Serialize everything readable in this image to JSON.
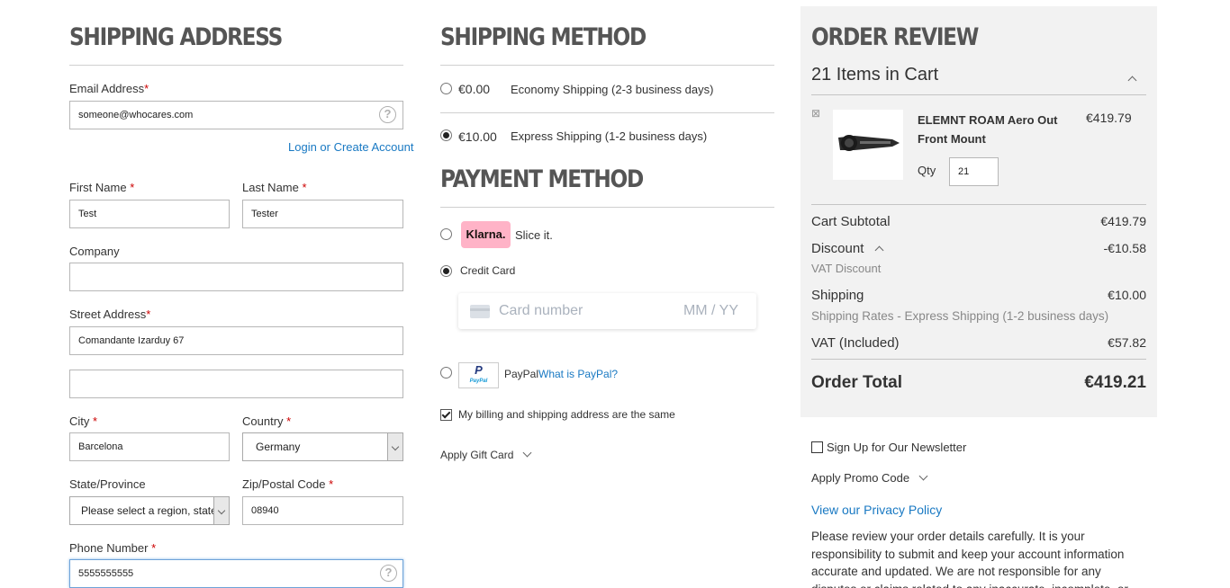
{
  "shipping_address": {
    "title": "SHIPPING ADDRESS",
    "email_label": "Email Address",
    "email_value": "someone@whocares.com",
    "login_link": "Login or Create Account",
    "first_name_label": "First Name",
    "first_name_value": "Test",
    "last_name_label": "Last Name",
    "last_name_value": "Tester",
    "company_label": "Company",
    "company_value": "",
    "street_label": "Street Address",
    "street_value_1": "Comandante Izarduy 67",
    "street_value_2": "",
    "city_label": "City",
    "city_value": "Barcelona",
    "country_label": "Country",
    "country_value": "Germany",
    "state_label": "State/Province",
    "state_value": "Please select a region, state or province.",
    "zip_label": "Zip/Postal Code",
    "zip_value": "08940",
    "phone_label": "Phone Number",
    "phone_value": "5555555555",
    "required_mark": "*",
    "help_glyph": "?"
  },
  "shipping_method": {
    "title": "SHIPPING METHOD",
    "options": [
      {
        "price": "€0.00",
        "label": "Economy Shipping (2-3 business days)",
        "selected": false
      },
      {
        "price": "€10.00",
        "label": "Express Shipping (1-2 business days)",
        "selected": true
      }
    ]
  },
  "payment_method": {
    "title": "PAYMENT METHOD",
    "klarna_logo": "Klarna.",
    "klarna_label": "Slice it.",
    "credit_card_label": "Credit Card",
    "card_number_placeholder": "Card number",
    "expiry_placeholder": "MM / YY",
    "paypal_logo": "PayPal",
    "paypal_label": "PayPal",
    "paypal_link": "What is PayPal?",
    "billing_same_label": "My billing and shipping address are the same",
    "billing_same_checked": true,
    "gift_card_label": "Apply Gift Card"
  },
  "order_review": {
    "title": "ORDER REVIEW",
    "items_in_cart": "21 Items in Cart",
    "remove_glyph": "⊠",
    "item": {
      "name": "ELEMNT ROAM Aero Out Front Mount",
      "price": "€419.79",
      "qty_label": "Qty",
      "qty_value": "21"
    },
    "subtotal_label": "Cart Subtotal",
    "subtotal_value": "€419.79",
    "discount_label": "Discount",
    "discount_value": "-€10.58",
    "discount_detail": "VAT Discount",
    "shipping_label": "Shipping",
    "shipping_value": "€10.00",
    "shipping_detail": "Shipping Rates - Express Shipping (1-2 business days)",
    "vat_label": "VAT (Included)",
    "vat_value": "€57.82",
    "total_label": "Order Total",
    "total_value": "€419.21"
  },
  "sidebar_extra": {
    "newsletter_label": "Sign Up for Our Newsletter",
    "promo_label": "Apply Promo Code",
    "privacy_link": "View our Privacy Policy",
    "disclaimer": "Please review your order details carefully. It is your responsibility to submit and keep your account information accurate and updated. We are not responsible for any disputes or claims related to any inaccurate, incomplete, or untimely"
  },
  "colors": {
    "link": "#1979c3",
    "required": "#cc0000",
    "review_bg": "#f2f2f2",
    "klarna_pink": "#ffb3c7"
  }
}
